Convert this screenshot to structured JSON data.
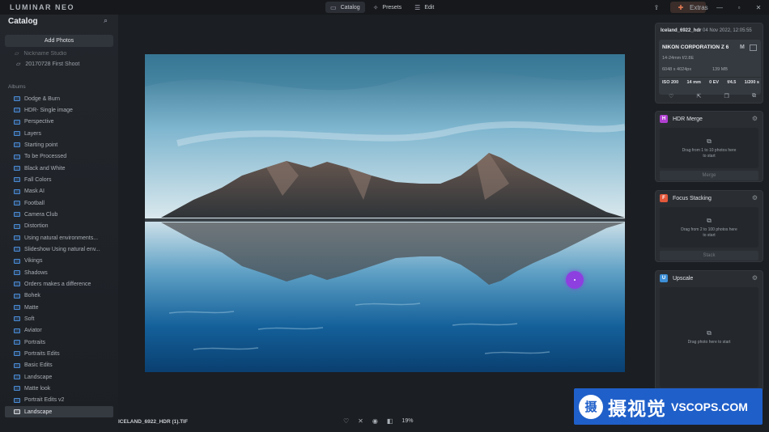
{
  "app": {
    "logo_text": "LUMINAR NEO"
  },
  "nav": {
    "tabs": [
      {
        "label": "Catalog",
        "icon": "catalog-icon",
        "active": true
      },
      {
        "label": "Presets",
        "icon": "presets-icon",
        "active": false
      },
      {
        "label": "Edit",
        "icon": "edit-icon",
        "active": false
      }
    ]
  },
  "window": {
    "extras_label": "Extras"
  },
  "sidebar": {
    "title": "Catalog",
    "add_photos_label": "Add Photos",
    "partial_item": "Nickname Studio",
    "shoot_item": "20170728 First Shoot",
    "albums_heading": "Albums",
    "albums": [
      "Dodge & Burn",
      "HDR- Single image",
      "Perspective",
      "Layers",
      "Starting point",
      "To be Processed",
      "Black and White",
      "Fall Colors",
      "Mask AI",
      "Football",
      "Camera Club",
      "Distortion",
      "Using natural environments...",
      "Slideshow Using natural env...",
      "Vikings",
      "Shadows",
      "Orders makes a difference",
      "Bohek",
      "Matte",
      "Soft",
      "Aviator",
      "Portraits",
      "Portraits Edits",
      "Basic Edits",
      "Landscape",
      "Matte look",
      "Portrait Edits v2",
      "Landscape"
    ],
    "selected_album_index": 27
  },
  "bottombar": {
    "filename": "ICELAND_6922_HDR (1).TIF",
    "zoom": "19%"
  },
  "info": {
    "filename": "Iceland_6922_hdr",
    "date": "04 Nov 2022, 12:05:55",
    "camera": "NIKON CORPORATION Z 6",
    "mode": "M",
    "lens": "14-24mm f/2.8E",
    "resolution": "6048 x 4024px",
    "size": "139 MB",
    "exif": {
      "iso": "ISO 200",
      "focal": "14 mm",
      "ev": "0 EV",
      "aperture": "f/4.5",
      "shutter": "1/200 s"
    }
  },
  "tools": {
    "hdr": {
      "title": "HDR Merge",
      "badge": "H",
      "badge_color": "#b03fd0",
      "drop_text": "Drag from 1 to 10 photos here to start",
      "button": "Merge"
    },
    "focus": {
      "title": "Focus Stacking",
      "badge": "F",
      "badge_color": "#e3573b",
      "drop_text": "Drag from 2 to 100 photos here to start",
      "button": "Stack"
    },
    "upscale": {
      "title": "Upscale",
      "badge": "U",
      "badge_color": "#3d8fd6",
      "drop_text": "Drag photo here to start"
    }
  },
  "watermark": {
    "seal": "摄",
    "cn": "摄视觉",
    "en": "VSCOPS.COM"
  }
}
